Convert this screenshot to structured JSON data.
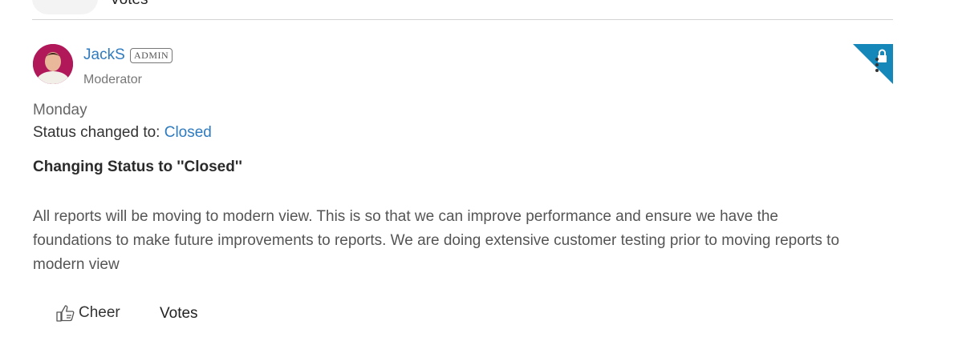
{
  "top": {
    "votes_label": "Votes"
  },
  "post": {
    "author": {
      "name": "JackS",
      "badge": "ADMIN",
      "role": "Moderator"
    },
    "date": "Monday",
    "status": {
      "prefix": "Status changed to: ",
      "value": "Closed"
    },
    "title": "Changing Status to ''Closed''",
    "body": "All reports will be moving to modern view. This is so that we can improve performance and ensure we have the foundations to make future improvements to reports. We are doing extensive customer testing prior to moving reports to modern view",
    "actions": {
      "cheer_label": "Cheer",
      "votes_label": "Votes"
    },
    "locked": true
  },
  "colors": {
    "link": "#2f7bbf",
    "lock_corner": "#1587b8"
  },
  "icons": {
    "cheer": "thumbs-up-icon",
    "lock": "lock-icon",
    "menu": "kebab-menu-icon"
  }
}
